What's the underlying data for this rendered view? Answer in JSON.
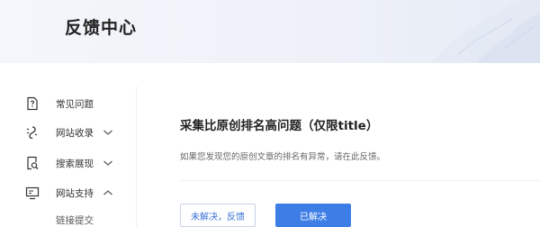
{
  "header": {
    "title": "反馈中心"
  },
  "sidebar": {
    "items": [
      {
        "label": "常见问题",
        "icon": "question-doc-icon",
        "has_chevron": false
      },
      {
        "label": "网站收录",
        "icon": "spider-icon",
        "has_chevron": true,
        "expanded": false
      },
      {
        "label": "搜索展现",
        "icon": "search-doc-icon",
        "has_chevron": true,
        "expanded": false
      },
      {
        "label": "网站支持",
        "icon": "monitor-icon",
        "has_chevron": true,
        "expanded": true
      }
    ],
    "sub_items": [
      {
        "label": "链接提交"
      }
    ]
  },
  "main": {
    "question_title": "采集比原创排名高问题（仅限title）",
    "description": "如果您发现您的原创文章的排名有异常，请在此反馈。",
    "buttons": {
      "unsolved_label": "未解决，反馈",
      "solved_label": "已解决"
    }
  },
  "colors": {
    "accent": "#3d7ee6",
    "header_bg": "#eef1f8",
    "text_primary": "#222222",
    "text_secondary": "#666666"
  }
}
